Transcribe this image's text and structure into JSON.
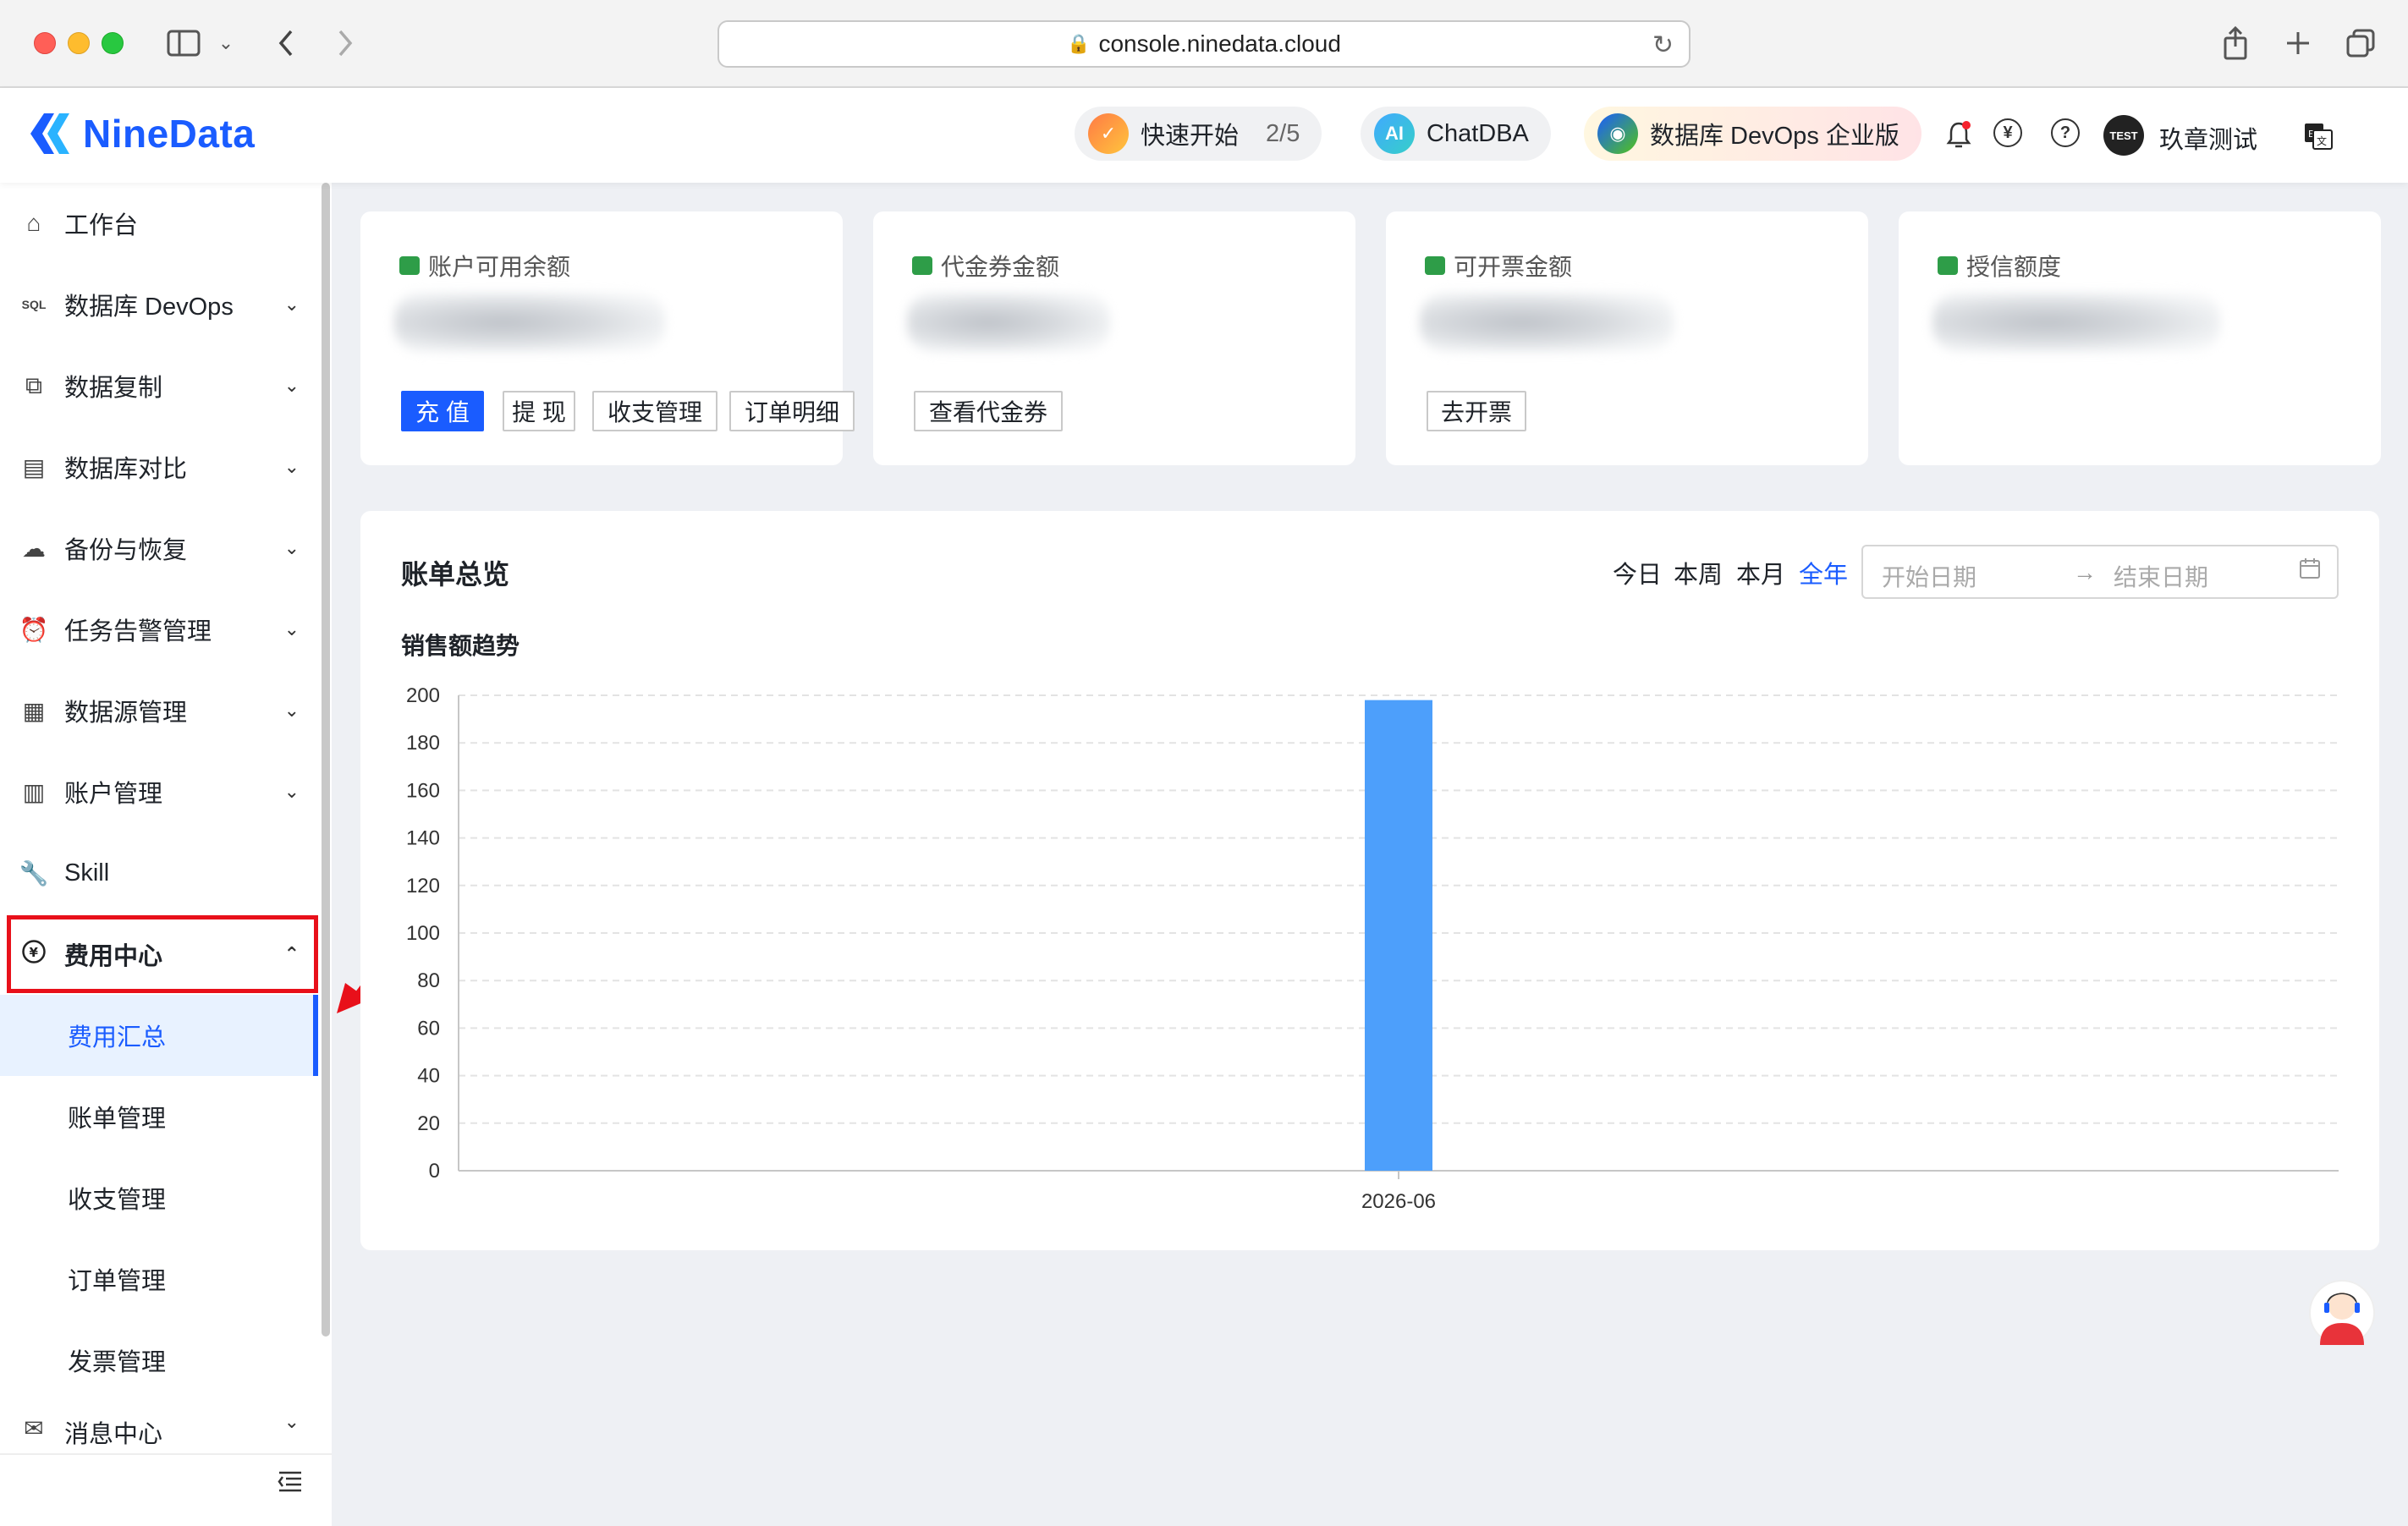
{
  "browser": {
    "url": "console.ninedata.cloud"
  },
  "header": {
    "logo_text": "NineData",
    "quick_start_label": "快速开始",
    "quick_start_progress": "2/5",
    "chatdba_label": "ChatDBA",
    "devops_label": "数据库 DevOps 企业版",
    "user_name": "玖章测试",
    "user_avatar_text": "TEST"
  },
  "sidebar": {
    "items": [
      {
        "label": "工作台",
        "icon": "home-icon"
      },
      {
        "label": "数据库 DevOps",
        "icon": "sql-icon"
      },
      {
        "label": "数据复制",
        "icon": "copy-icon"
      },
      {
        "label": "数据库对比",
        "icon": "compare-icon"
      },
      {
        "label": "备份与恢复",
        "icon": "cloud-icon"
      },
      {
        "label": "任务告警管理",
        "icon": "alarm-icon"
      },
      {
        "label": "数据源管理",
        "icon": "datasource-icon"
      },
      {
        "label": "账户管理",
        "icon": "account-icon"
      },
      {
        "label": "Skill",
        "icon": "wrench-icon"
      },
      {
        "label": "费用中心",
        "icon": "yen-icon"
      }
    ],
    "sub_items": [
      "费用汇总",
      "账单管理",
      "收支管理",
      "订单管理",
      "发票管理"
    ],
    "more_item": "消息中心"
  },
  "cards": {
    "balance": {
      "title": "账户可用余额",
      "buttons": [
        "充 值",
        "提 现",
        "收支管理",
        "订单明细"
      ]
    },
    "voucher": {
      "title": "代金券金额",
      "button": "查看代金券"
    },
    "invoice": {
      "title": "可开票金额",
      "button": "去开票"
    },
    "credit": {
      "title": "授信额度"
    }
  },
  "bill_overview": {
    "title": "账单总览",
    "ranges": [
      "今日",
      "本周",
      "本月",
      "全年"
    ],
    "active_range": "全年",
    "start_placeholder": "开始日期",
    "end_placeholder": "结束日期",
    "chart_title": "销售额趋势"
  },
  "colors": {
    "brand": "#1a5cff",
    "bar": "#4d9ffb",
    "highlight_box": "#e8101a"
  },
  "chart_data": {
    "type": "bar",
    "title": "销售额趋势",
    "categories": [
      "2026-06"
    ],
    "values": [
      198
    ],
    "ylim": [
      0,
      200
    ],
    "yticks": [
      0,
      20,
      40,
      60,
      80,
      100,
      120,
      140,
      160,
      180,
      200
    ],
    "xlabel": "",
    "ylabel": "",
    "grid": true
  }
}
